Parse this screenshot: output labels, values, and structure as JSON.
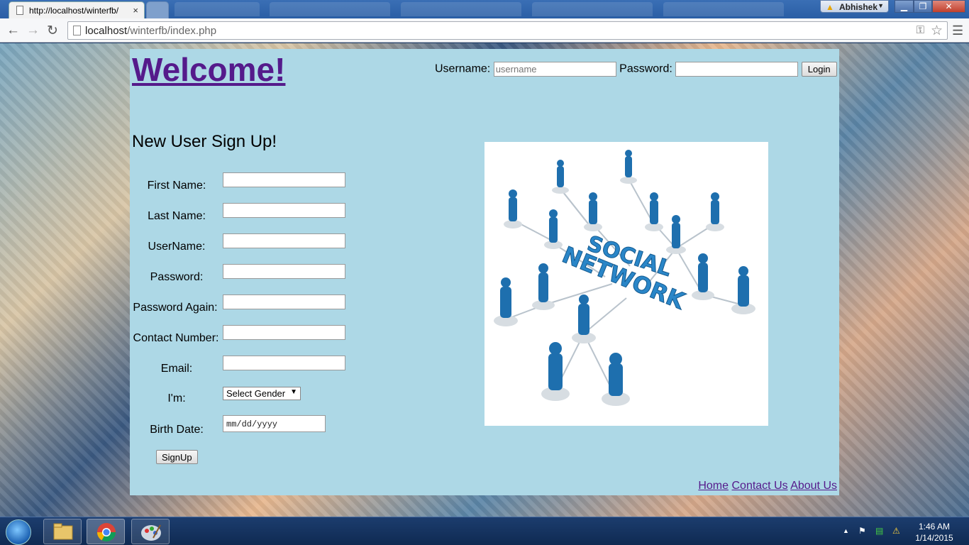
{
  "browser": {
    "tab_title": "http://localhost/winterfb/",
    "tab_close": "×",
    "url_host": "localhost",
    "url_path": "/winterfb/index.php",
    "user_name": "Abhishek",
    "win_min": "▁",
    "win_max": "❐",
    "win_close": "✕"
  },
  "header": {
    "welcome": "Welcome!",
    "username_label": "Username:",
    "username_placeholder": "username",
    "password_label": "Password:",
    "login_button": "Login"
  },
  "signup": {
    "title": "New User Sign Up!",
    "first_name": "First Name:",
    "last_name": "Last Name:",
    "username": "UserName:",
    "password": "Password:",
    "password_again": "Password Again:",
    "contact_number": "Contact Number:",
    "email": "Email:",
    "gender_label": "I'm:",
    "gender_selected": "Select Gender",
    "birth_date_label": "Birth Date:",
    "birth_date_value": "mm/dd/yyyy",
    "submit": "SignUp"
  },
  "illustration": {
    "line1": "SOCIAL",
    "line2": "NETWORK"
  },
  "footer": {
    "home": "Home",
    "contact": "Contact Us",
    "about": "About Us"
  },
  "taskbar": {
    "time": "1:46 AM",
    "date": "1/14/2015"
  },
  "colors": {
    "content_bg": "#add8e6",
    "visited_link": "#551a8b"
  }
}
